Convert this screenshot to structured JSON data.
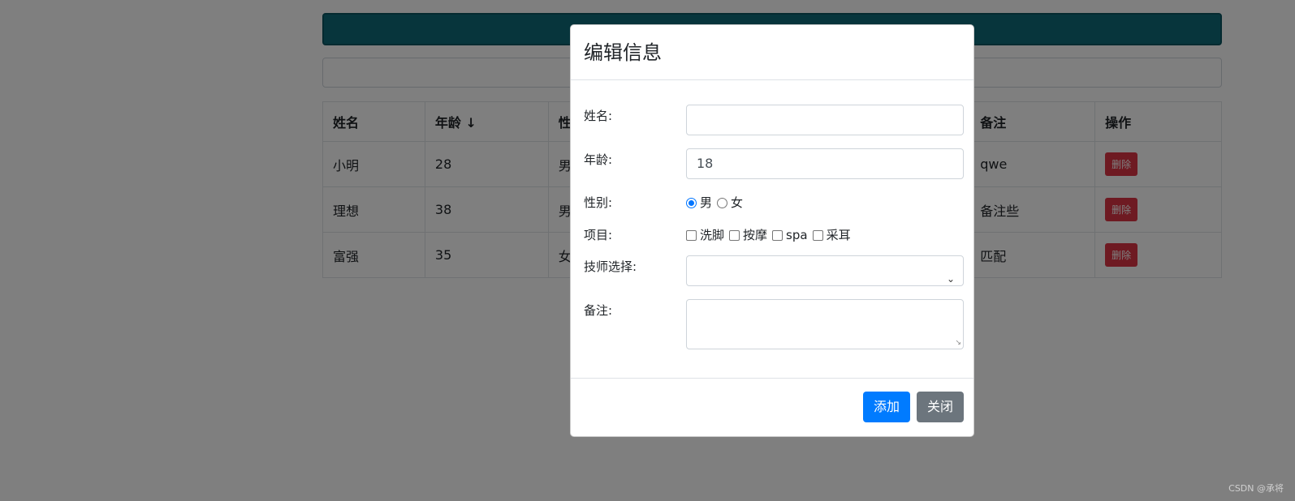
{
  "table": {
    "headers": [
      "姓名",
      "年龄 ↓",
      "性",
      "",
      "",
      "备注",
      "操作"
    ],
    "rows": [
      {
        "name": "小明",
        "age": "28",
        "sex": "男",
        "remark": "qwe",
        "op": "删除"
      },
      {
        "name": "理想",
        "age": "38",
        "sex": "男",
        "remark": "备注些",
        "op": "删除"
      },
      {
        "name": "富强",
        "age": "35",
        "sex": "女",
        "remark": "匹配",
        "op": "删除"
      }
    ]
  },
  "modal": {
    "title": "编辑信息",
    "fields": {
      "name_label": "姓名:",
      "name_value": "",
      "age_label": "年龄:",
      "age_value": "18",
      "sex_label": "性别:",
      "sex_options": [
        "男",
        "女"
      ],
      "sex_selected": "男",
      "items_label": "项目:",
      "items_options": [
        "洗脚",
        "按摩",
        "spa",
        "采耳"
      ],
      "tech_label": "技师选择:",
      "tech_value": "",
      "remark_label": "备注:",
      "remark_value": ""
    },
    "add_button": "添加",
    "close_button": "关闭"
  },
  "watermark": "CSDN @承将",
  "colors": {
    "top_bar": "#0f6b78",
    "add": "#007bff",
    "close": "#6c757d",
    "delete": "#dc3545"
  }
}
